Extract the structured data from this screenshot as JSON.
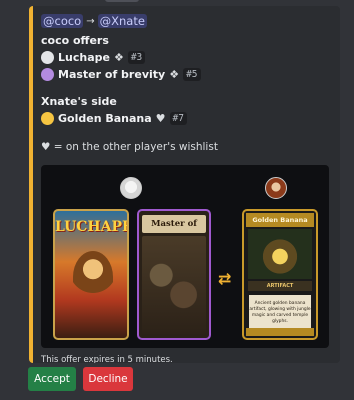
{
  "header": {
    "from_mention": "@coco",
    "arrow": "→",
    "to_mention": "@Xnate"
  },
  "offer": {
    "title": "coco offers",
    "cards": [
      {
        "name": "Luchape",
        "marker": "❖",
        "id": "#3",
        "dot_color": "#e3e5e8"
      },
      {
        "name": "Master of brevity",
        "marker": "❖",
        "id": "#5",
        "dot_color": "#b38be0"
      }
    ]
  },
  "receive": {
    "title": "Xnate's side",
    "cards": [
      {
        "name": "Golden Banana",
        "marker": "♥",
        "id": "#7",
        "dot_color": "#f6c542"
      }
    ]
  },
  "wishlist_note": "♥ = on the other player's wishlist",
  "preview": {
    "swap_symbol": "⇄",
    "left_cards": [
      {
        "title": "LUCHAPE"
      },
      {
        "title": "Master of Brevity"
      }
    ],
    "right_card": {
      "title": "Golden Banana",
      "type": "ARTIFACT",
      "text": "Ancient golden banana artifact, glowing with jungle magic and carved temple glyphs."
    }
  },
  "expiry": "This offer expires in 5 minutes.",
  "actions": {
    "accept": "Accept",
    "decline": "Decline"
  },
  "colors": {
    "accent_bar": "#f0b232",
    "accept": "#248046",
    "decline": "#da373c"
  }
}
